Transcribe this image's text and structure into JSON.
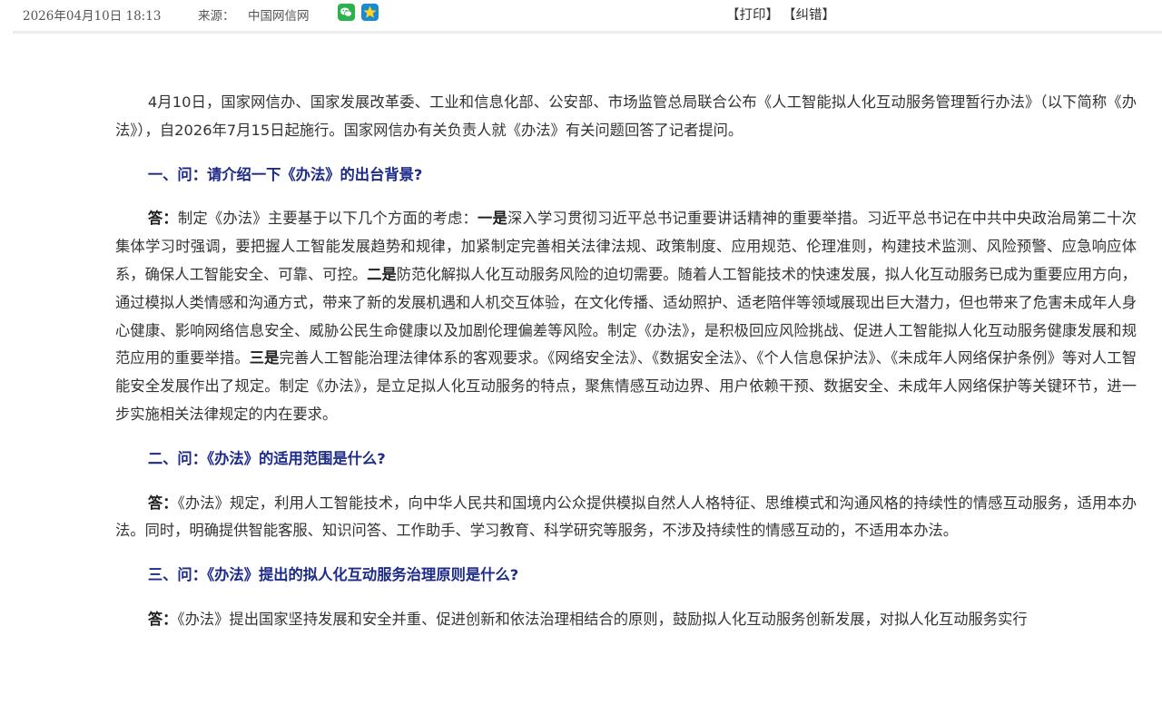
{
  "meta": {
    "date": "2026年04月10日  18:13",
    "source_label": "来源：",
    "source": "中国网信网",
    "print_label": "【打印】",
    "fix_label": "【纠错】"
  },
  "icons": {
    "share_wechat": "wechat-icon",
    "share_qzone": "qzone-star-icon"
  },
  "colors": {
    "question_heading": "#1d2b88",
    "wechat": "#2bb24c",
    "qzone": "#1a8bd1"
  },
  "article": {
    "lead": "4月10日，国家网信办、国家发展改革委、工业和信息化部、公安部、市场监管总局联合公布《人工智能拟人化互动服务管理暂行办法》（以下简称《办法》），自2026年7月15日起施行。国家网信办有关负责人就《办法》有关问题回答了记者提问。",
    "q1": "一、问：请介绍一下《办法》的出台背景?",
    "a1": {
      "label": "答：",
      "t0": "制定《办法》主要基于以下几个方面的考虑：",
      "k1": "一是",
      "t1": "深入学习贯彻习近平总书记重要讲话精神的重要举措。习近平总书记在中共中央政治局第二十次集体学习时强调，要把握人工智能发展趋势和规律，加紧制定完善相关法律法规、政策制度、应用规范、伦理准则，构建技术监测、风险预警、应急响应体系，确保人工智能安全、可靠、可控。",
      "k2": "二是",
      "t2": "防范化解拟人化互动服务风险的迫切需要。随着人工智能技术的快速发展，拟人化互动服务已成为重要应用方向，通过模拟人类情感和沟通方式，带来了新的发展机遇和人机交互体验，在文化传播、适幼照护、适老陪伴等领域展现出巨大潜力，但也带来了危害未成年人身心健康、影响网络信息安全、威胁公民生命健康以及加剧伦理偏差等风险。制定《办法》，是积极回应风险挑战、促进人工智能拟人化互动服务健康发展和规范应用的重要举措。",
      "k3": "三是",
      "t3": "完善人工智能治理法律体系的客观要求。《网络安全法》、《数据安全法》、《个人信息保护法》、《未成年人网络保护条例》等对人工智能安全发展作出了规定。制定《办法》，是立足拟人化互动服务的特点，聚焦情感互动边界、用户依赖干预、数据安全、未成年人网络保护等关键环节，进一步实施相关法律规定的内在要求。"
    },
    "q2": "二、问：《办法》的适用范围是什么?",
    "a2": {
      "label": "答：",
      "text": "《办法》规定，利用人工智能技术，向中华人民共和国境内公众提供模拟自然人人格特征、思维模式和沟通风格的持续性的情感互动服务，适用本办法。同时，明确提供智能客服、知识问答、工作助手、学习教育、科学研究等服务，不涉及持续性的情感互动的，不适用本办法。"
    },
    "q3": "三、问：《办法》提出的拟人化互动服务治理原则是什么?",
    "a3": {
      "label": "答：",
      "text": "《办法》提出国家坚持发展和安全并重、促进创新和依法治理相结合的原则，鼓励拟人化互动服务创新发展，对拟人化互动服务实行"
    }
  }
}
